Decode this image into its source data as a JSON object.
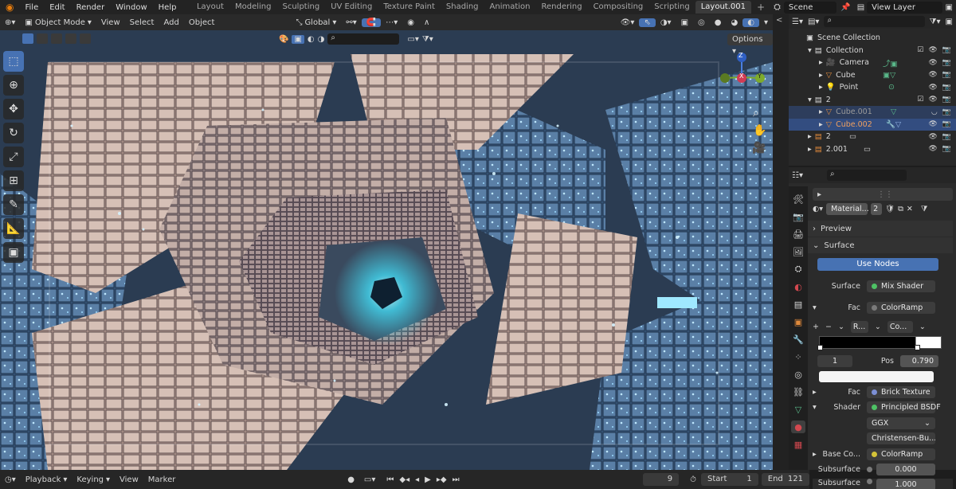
{
  "topbar": {
    "menus": [
      "File",
      "Edit",
      "Render",
      "Window",
      "Help"
    ],
    "workspaces": [
      "Layout",
      "Modeling",
      "Sculpting",
      "UV Editing",
      "Texture Paint",
      "Shading",
      "Animation",
      "Rendering",
      "Compositing",
      "Scripting",
      "Layout.001"
    ],
    "active_workspace": "Layout.001",
    "add_tab_label": "+",
    "scene": "Scene",
    "view_layer": "View Layer"
  },
  "viewport_header": {
    "mode": "Object Mode",
    "menus": [
      "View",
      "Select",
      "Add",
      "Object"
    ],
    "transform_orientation": "Global",
    "options_label": "Options"
  },
  "navigation_gizmo": {
    "x": "X",
    "y": "Y",
    "z": "Z"
  },
  "outliner": {
    "rows": [
      {
        "label": "Scene Collection",
        "indent": 0,
        "icon": "scene-collection-icon"
      },
      {
        "label": "Collection",
        "indent": 1,
        "icon": "collection-icon"
      },
      {
        "label": "Camera",
        "indent": 2,
        "icon": "camera-object-icon"
      },
      {
        "label": "Cube",
        "indent": 2,
        "icon": "mesh-object-icon"
      },
      {
        "label": "Point",
        "indent": 2,
        "icon": "light-object-icon"
      },
      {
        "label": "2",
        "indent": 1,
        "icon": "collection-icon"
      },
      {
        "label": "Cube.001",
        "indent": 2,
        "icon": "mesh-object-icon"
      },
      {
        "label": "Cube.002",
        "indent": 2,
        "icon": "mesh-object-icon"
      },
      {
        "label": "2",
        "indent": 1,
        "icon": "collection-icon"
      },
      {
        "label": "2.001",
        "indent": 1,
        "icon": "collection-icon"
      }
    ]
  },
  "properties": {
    "material_name": "Material...",
    "material_users": "2",
    "preview_label": "Preview",
    "surface_label": "Surface",
    "use_nodes_label": "Use Nodes",
    "surface_field_label": "Surface",
    "surface_shader": "Mix Shader",
    "fac_label": "Fac",
    "fac_value": "ColorRamp",
    "ramp_interp": "R...",
    "ramp_mode": "Co...",
    "ramp_index": "1",
    "ramp_pos_label": "Pos",
    "ramp_pos_value": "0.790",
    "fac2_label": "Fac",
    "fac2_value": "Brick Texture",
    "shader_label": "Shader",
    "shader_value": "Principled BSDF",
    "distribution": "GGX",
    "subsurface_method": "Christensen-Bu...",
    "base_color_label": "Base Co...",
    "base_color_value": "ColorRamp",
    "subsurface_label": "Subsurface",
    "subsurface_value": "0.000",
    "subsurface2_label": "Subsurface",
    "subsurface2_value": "1.000"
  },
  "timeline": {
    "menus": [
      "Playback",
      "Keying",
      "View",
      "Marker"
    ],
    "current_frame": "9",
    "start_label": "Start",
    "start_value": "1",
    "end_label": "End",
    "end_value": "121"
  },
  "colors": {
    "accent": "#4772b3",
    "selected_row": "#334d80",
    "socket_green": "#4ec265",
    "socket_yellow": "#d4c338",
    "panel_bg": "#2b2b2b"
  }
}
